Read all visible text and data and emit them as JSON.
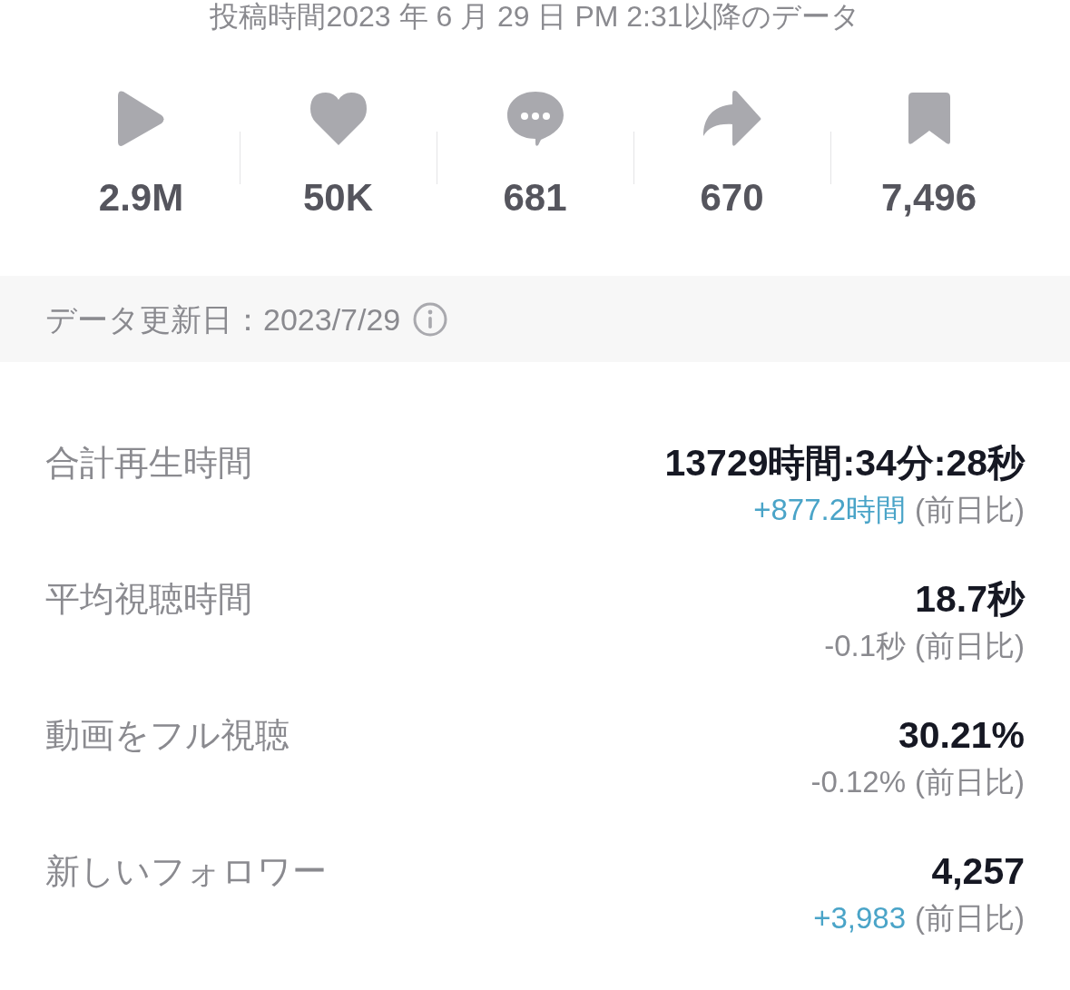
{
  "header": {
    "title": "投稿時間2023 年 6 月 29 日 PM 2:31以降のデータ"
  },
  "stats": [
    {
      "kind": "plays",
      "value": "2.9M"
    },
    {
      "kind": "likes",
      "value": "50K"
    },
    {
      "kind": "comments",
      "value": "681"
    },
    {
      "kind": "shares",
      "value": "670"
    },
    {
      "kind": "saves",
      "value": "7,496"
    }
  ],
  "update_banner": {
    "text": "データ更新日：2023/7/29"
  },
  "metrics": [
    {
      "label": "合計再生時間",
      "value": "13729時間:34分:28秒",
      "change": {
        "text": "+877.2時間",
        "color": "#4aa4c8"
      },
      "note": "(前日比)"
    },
    {
      "label": "平均視聴時間",
      "value": "18.7秒",
      "change": {
        "text": "-0.1秒",
        "color": "#8a8a8f"
      },
      "note": "(前日比)"
    },
    {
      "label": "動画をフル視聴",
      "value": "30.21%",
      "change": {
        "text": "-0.12%",
        "color": "#8a8a8f"
      },
      "note": "(前日比)"
    },
    {
      "label": "新しいフォロワー",
      "value": "4,257",
      "change": {
        "text": "+3,983",
        "color": "#4aa4c8"
      },
      "note": "(前日比)"
    }
  ]
}
